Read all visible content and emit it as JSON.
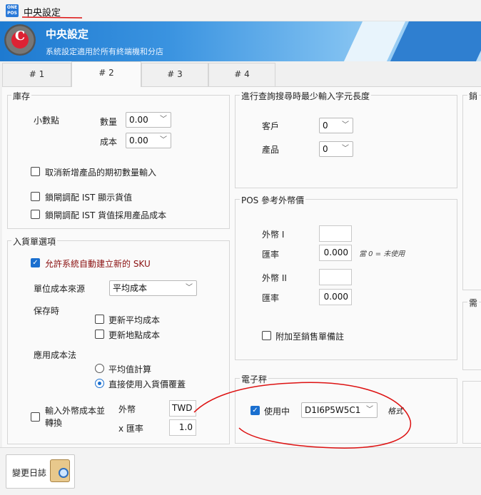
{
  "window": {
    "title": "中央設定",
    "app_icon_text": "ONE POS"
  },
  "banner": {
    "title": "中央設定",
    "subtitle": "系統設定適用於所有終端機和分店",
    "logo_letter": "C"
  },
  "tabs": [
    {
      "label": "# 1"
    },
    {
      "label": "# 2"
    },
    {
      "label": "# 3"
    },
    {
      "label": "# 4"
    }
  ],
  "inventory": {
    "title": "庫存",
    "decimal_label": "小數點",
    "qty_label": "數量",
    "qty_value": "0.00",
    "cost_label": "成本",
    "cost_value": "0.00",
    "cancel_initial_qty": "取消新增產品的期初數量輸入",
    "hide_ist_value": "鎖閘調配 IST 顯示貨值",
    "ist_use_product_cost": "鎖閘調配 IST 貨值採用產品成本"
  },
  "receiving": {
    "title": "入貨單選項",
    "auto_sku": "允許系統自動建立新的 SKU",
    "unit_cost_source_label": "單位成本來源",
    "unit_cost_source_value": "平均成本",
    "on_save_label": "保存時",
    "update_avg_cost": "更新平均成本",
    "update_site_cost": "更新地點成本",
    "cost_method_label": "應用成本法",
    "avg_calc": "平均值計算",
    "direct_override": "直接使用入貨價覆蓋",
    "foreign_cost_label": "輸入外幣成本並轉換",
    "currency_label": "外幣",
    "currency_value": "TWD",
    "rate_label": "x 匯率",
    "rate_value": "1.0"
  },
  "search": {
    "title": "進行查詢搜尋時最少輸入字元長度",
    "customer_label": "客戶",
    "customer_value": "0",
    "product_label": "產品",
    "product_value": "0"
  },
  "pos_fx": {
    "title": "POS 參考外幣價",
    "fx1_label": "外幣 I",
    "fx1_value": "",
    "rate1_label": "匯率",
    "rate1_value": "0.000",
    "note": "當 0 = 未使用",
    "fx2_label": "外幣 II",
    "fx2_value": "",
    "rate2_label": "匯率",
    "rate2_value": "0.000",
    "attach_note": "附加至銷售單備註"
  },
  "scale": {
    "title": "電子秤",
    "use_label": "使用中",
    "format_value": "D1I6P5W5C1",
    "format_label": "格式"
  },
  "right_panel": {
    "title1": "銷",
    "title2": "需"
  },
  "footer": {
    "change_log": "變更日誌"
  },
  "colors": {
    "accent": "#1a6fcf",
    "banner": "#1e7ad0",
    "ink": "#d11"
  }
}
